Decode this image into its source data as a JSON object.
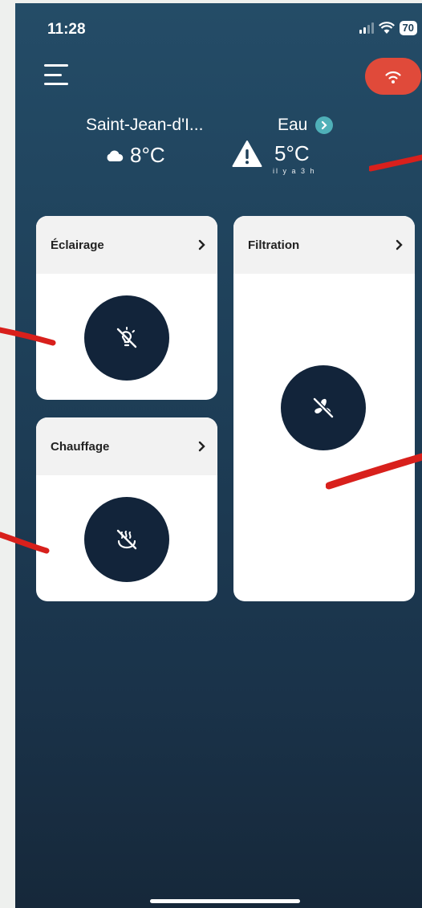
{
  "status": {
    "time": "11:28",
    "battery": "70"
  },
  "weather": {
    "city": "Saint-Jean-d'I...",
    "air_temp": "8°C",
    "water_label": "Eau",
    "water_temp": "5°C",
    "updated": "il y a 3 h"
  },
  "cards": {
    "lighting": {
      "title": "Éclairage"
    },
    "heating": {
      "title": "Chauffage"
    },
    "filtration": {
      "title": "Filtration"
    }
  },
  "icons": {
    "menu": "hamburger-menu-icon",
    "connection": "wifi-icon",
    "lighting": "lightbulb-off-icon",
    "heating": "heating-off-icon",
    "filtration": "fan-off-icon"
  },
  "colors": {
    "accent_connection": "#e04a3a",
    "water_chevron": "#4fb0b8",
    "control_circle": "#12243a",
    "card_header": "#f2f2f2"
  }
}
